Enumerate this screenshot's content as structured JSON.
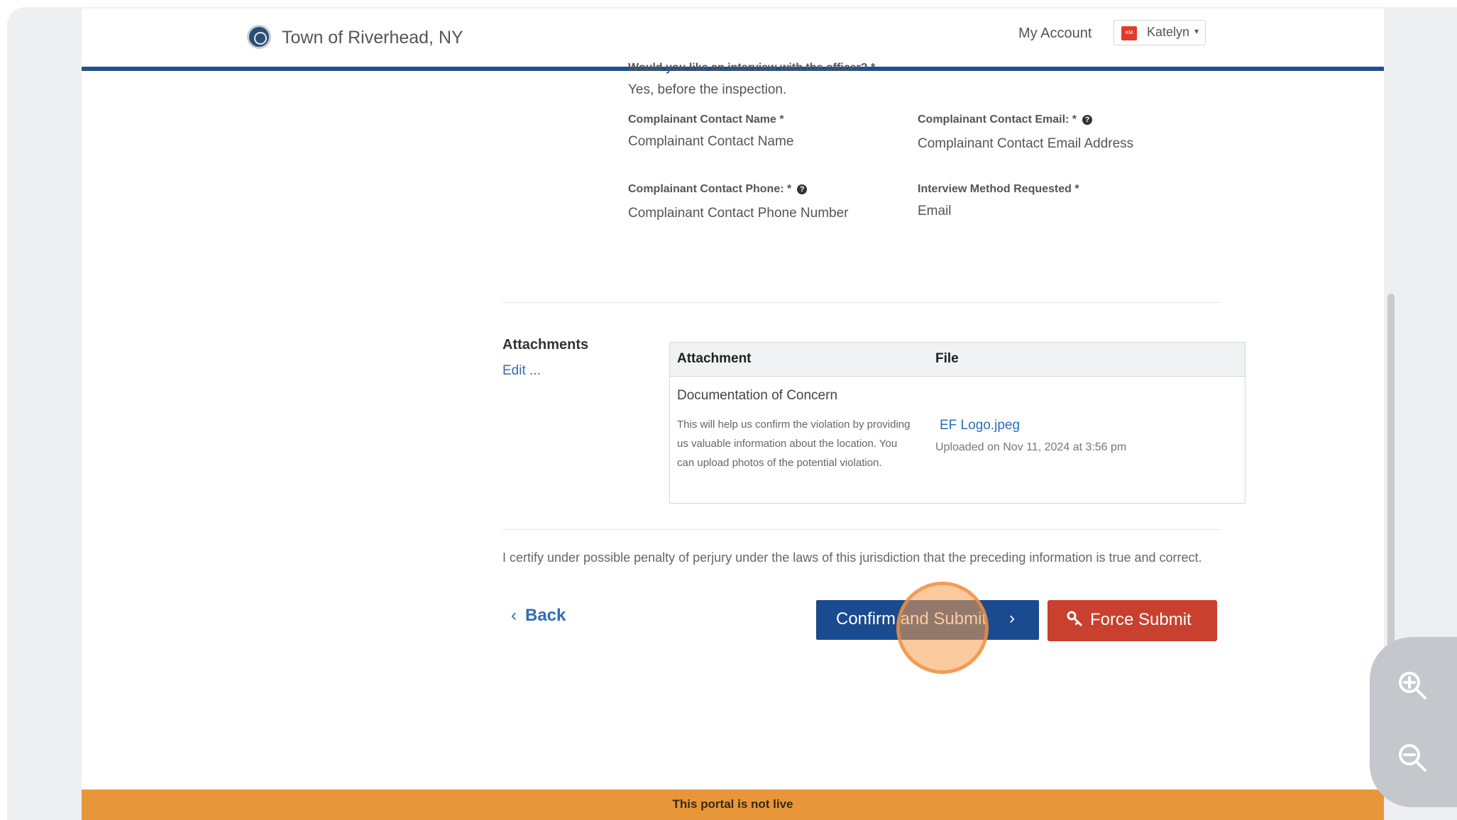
{
  "header": {
    "town_name": "Town of Riverhead, NY",
    "my_account": "My Account",
    "user_name": "Katelyn",
    "user_caret": "▾",
    "user_initials": "KM"
  },
  "fields": {
    "interview_question": {
      "label": "Would you like an interview with the officer? *",
      "value": "Yes, before the inspection."
    },
    "contact_name": {
      "label": "Complainant Contact Name *",
      "value": "Complainant Contact Name"
    },
    "contact_email": {
      "label": "Complainant Contact Email: *",
      "value": "Complainant Contact Email Address"
    },
    "contact_phone": {
      "label": "Complainant Contact Phone: *",
      "value": "Complainant Contact Phone Number"
    },
    "interview_method": {
      "label": "Interview Method Requested *",
      "value": "Email"
    }
  },
  "attachments": {
    "title": "Attachments",
    "edit_link": "Edit ...",
    "col_attachment": "Attachment",
    "col_file": "File",
    "row": {
      "name": "Documentation of Concern",
      "description": "This will help us confirm the violation by providing us valuable information about the location. You can upload photos of the potential violation.",
      "file_name": "EF Logo.jpeg",
      "uploaded": "Uploaded on Nov 11, 2024 at 3:56 pm"
    }
  },
  "certification": "I certify under possible penalty of perjury under the laws of this jurisdiction that the preceding information is true and correct.",
  "actions": {
    "back": "Back",
    "back_chevron": "‹",
    "confirm": "Confirm and Submit",
    "confirm_chevron": "›",
    "force": "Force Submit"
  },
  "banner": "This portal is not live",
  "colors": {
    "header_rule": "#1f4f91",
    "link": "#2f6db5",
    "confirm_button": "#1a4a8f",
    "force_button": "#c9402e",
    "banner": "#e8963a",
    "avatar": "#e23a2c"
  },
  "icons": {
    "help": "help-icon",
    "key": "key-icon",
    "zoom_in": "zoom-in-icon",
    "zoom_out": "zoom-out-icon",
    "seal": "town-seal-icon"
  }
}
